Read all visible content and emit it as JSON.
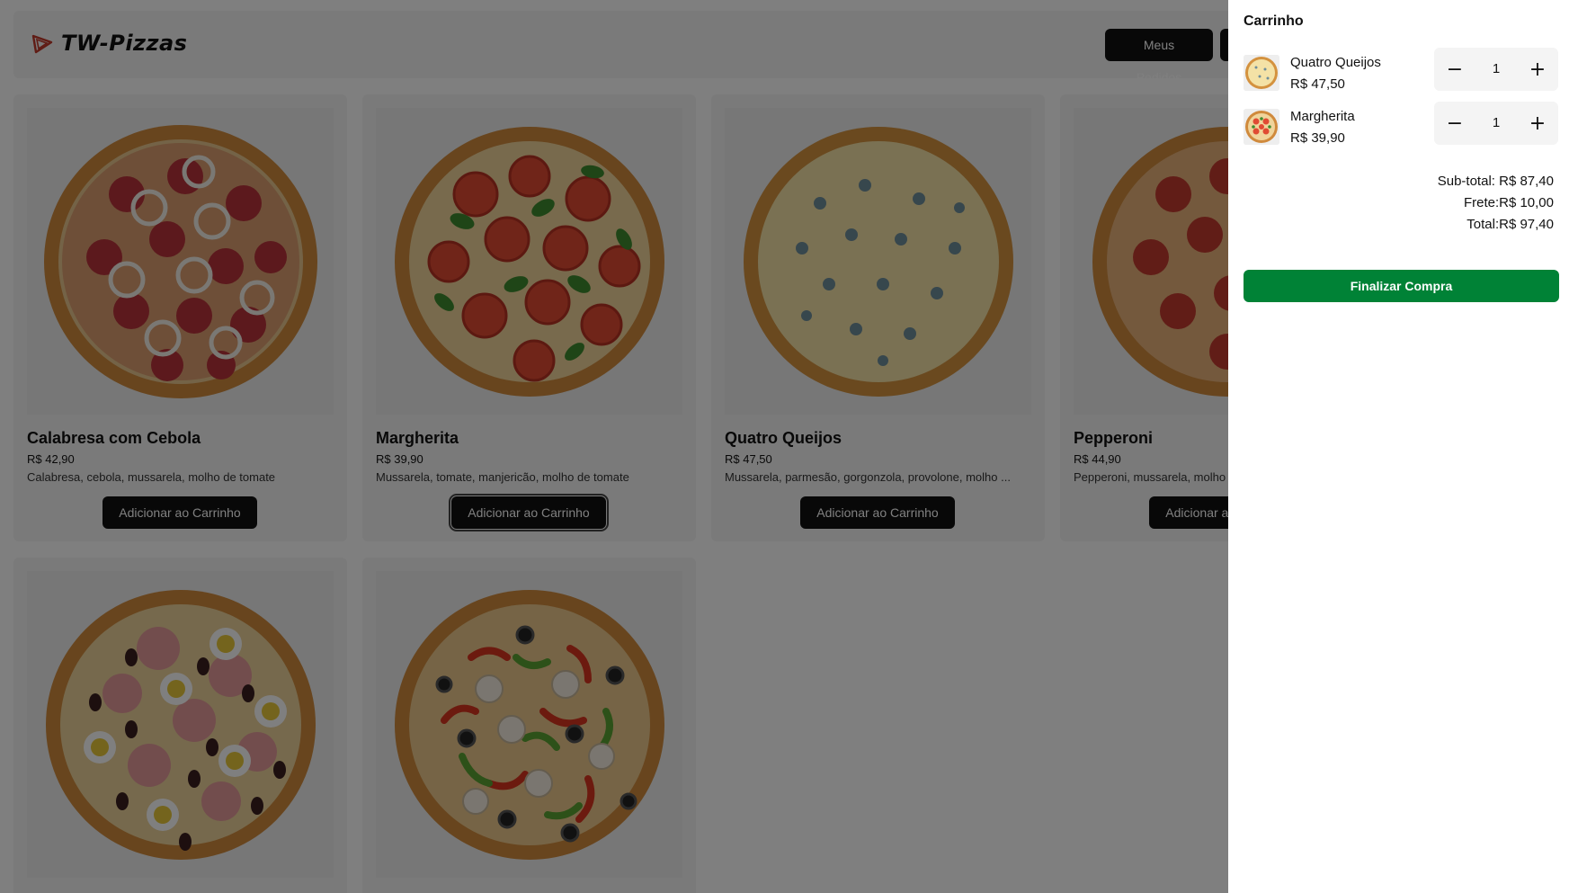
{
  "header": {
    "logo_text": "TW-Pizzas",
    "orders_button": "Meus Pedidos",
    "second_button": ""
  },
  "products": [
    {
      "name": "Calabresa com Cebola",
      "price": "R$ 42,90",
      "desc": "Calabresa, cebola, mussarela, molho de tomate",
      "button": "Adicionar ao Carrinho"
    },
    {
      "name": "Margherita",
      "price": "R$ 39,90",
      "desc": "Mussarela, tomate, manjericão, molho de tomate",
      "button": "Adicionar ao Carrinho"
    },
    {
      "name": "Quatro Queijos",
      "price": "R$ 47,50",
      "desc": "Mussarela, parmesão, gorgonzola, provolone, molho ...",
      "button": "Adicionar ao Carrinho"
    },
    {
      "name": "Pepperoni",
      "price": "R$ 44,90",
      "desc": "Pepperoni, mussarela, molho de tomate",
      "button": "Adicionar ao Carrinho"
    }
  ],
  "cart": {
    "title": "Carrinho",
    "items": [
      {
        "name": "Quatro Queijos",
        "price": "R$ 47,50",
        "qty": "1"
      },
      {
        "name": "Margherita",
        "price": "R$ 39,90",
        "qty": "1"
      }
    ],
    "subtotal": "Sub-total: R$ 87,40",
    "shipping": "Frete:R$ 10,00",
    "total": "Total:R$ 97,40",
    "checkout_button": "Finalizar Compra",
    "minus_symbol": "−",
    "plus_symbol": "+"
  },
  "colors": {
    "checkout": "#008236",
    "dark_button": "#111111",
    "overlay": "rgba(0,0,0,0.5)"
  }
}
